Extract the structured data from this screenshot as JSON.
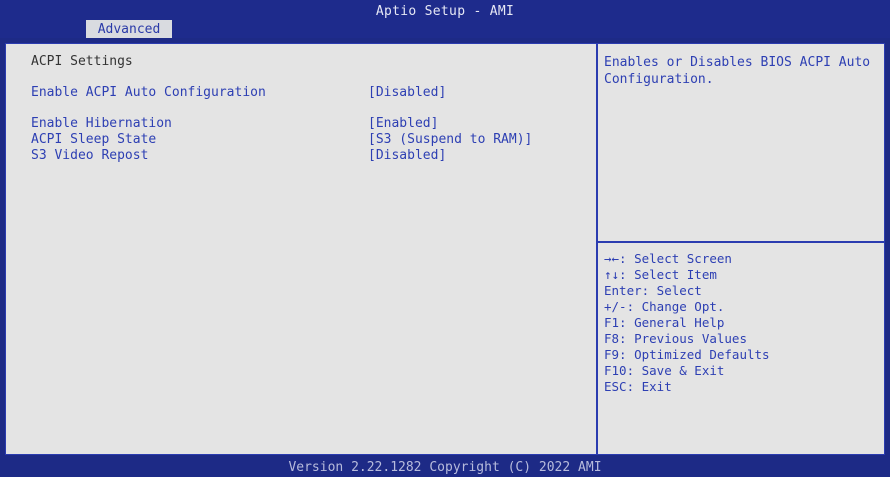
{
  "header": {
    "title": "Aptio Setup - AMI",
    "active_tab": "Advanced"
  },
  "main": {
    "section_title": "ACPI Settings",
    "settings": [
      {
        "label": "Enable ACPI Auto Configuration",
        "value": "[Disabled]"
      },
      {
        "label": "Enable Hibernation",
        "value": "[Enabled]"
      },
      {
        "label": "ACPI Sleep State",
        "value": "[S3 (Suspend to RAM)]"
      },
      {
        "label": "S3 Video Repost",
        "value": "[Disabled]"
      }
    ]
  },
  "help": {
    "text": "Enables or Disables BIOS ACPI Auto Configuration."
  },
  "keys": [
    "→←: Select Screen",
    "↑↓: Select Item",
    "Enter: Select",
    "+/-: Change Opt.",
    "F1: General Help",
    "F8: Previous Values",
    "F9: Optimized Defaults",
    "F10: Save & Exit",
    "ESC: Exit"
  ],
  "footer": {
    "text": "Version 2.22.1282 Copyright (C) 2022 AMI"
  },
  "colors": {
    "background": "#1d2a86",
    "panel": "#e4e4e4",
    "text_blue": "#2d3fb3"
  }
}
